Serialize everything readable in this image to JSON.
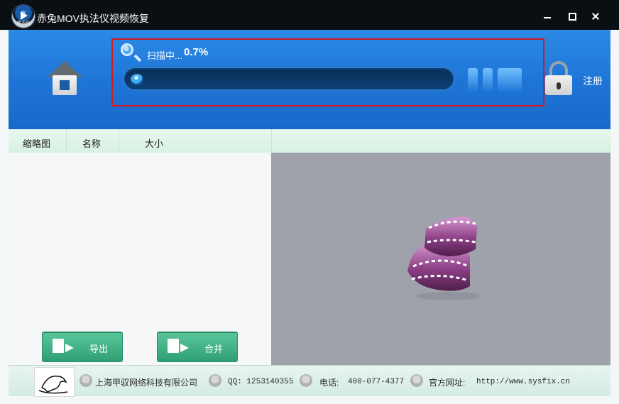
{
  "window": {
    "title": "赤兔MOV执法仪视频恢复",
    "icon_badge": "执法仪"
  },
  "header": {
    "scan": {
      "status_label": "扫描中...",
      "percent": "0.7%",
      "progress_fraction": 0.007
    },
    "register_label": "注册"
  },
  "table": {
    "columns": [
      "缩略图",
      "名称",
      "大小"
    ]
  },
  "actions": {
    "export_label": "导出",
    "merge_label": "合并"
  },
  "footer": {
    "company": "上海甲驭网络科技有限公司",
    "qq": "QQ: 1253140355",
    "phone_label": "电话:",
    "phone": "400-077-4377",
    "site_label": "官方网址:",
    "site_url": "http://www.sysfix.cn"
  },
  "colors": {
    "title_bar": "#0a0f14",
    "header_blue": "#1e74d6",
    "scan_border": "#d2191f",
    "button_green": "#3ab282",
    "preview_gray": "#9fa2ab"
  },
  "icons": {
    "home": "home-icon",
    "search": "search-icon",
    "pause": "pause-icon",
    "stop": "stop-icon",
    "lock": "lock-icon",
    "film": "film-reel-icon"
  }
}
